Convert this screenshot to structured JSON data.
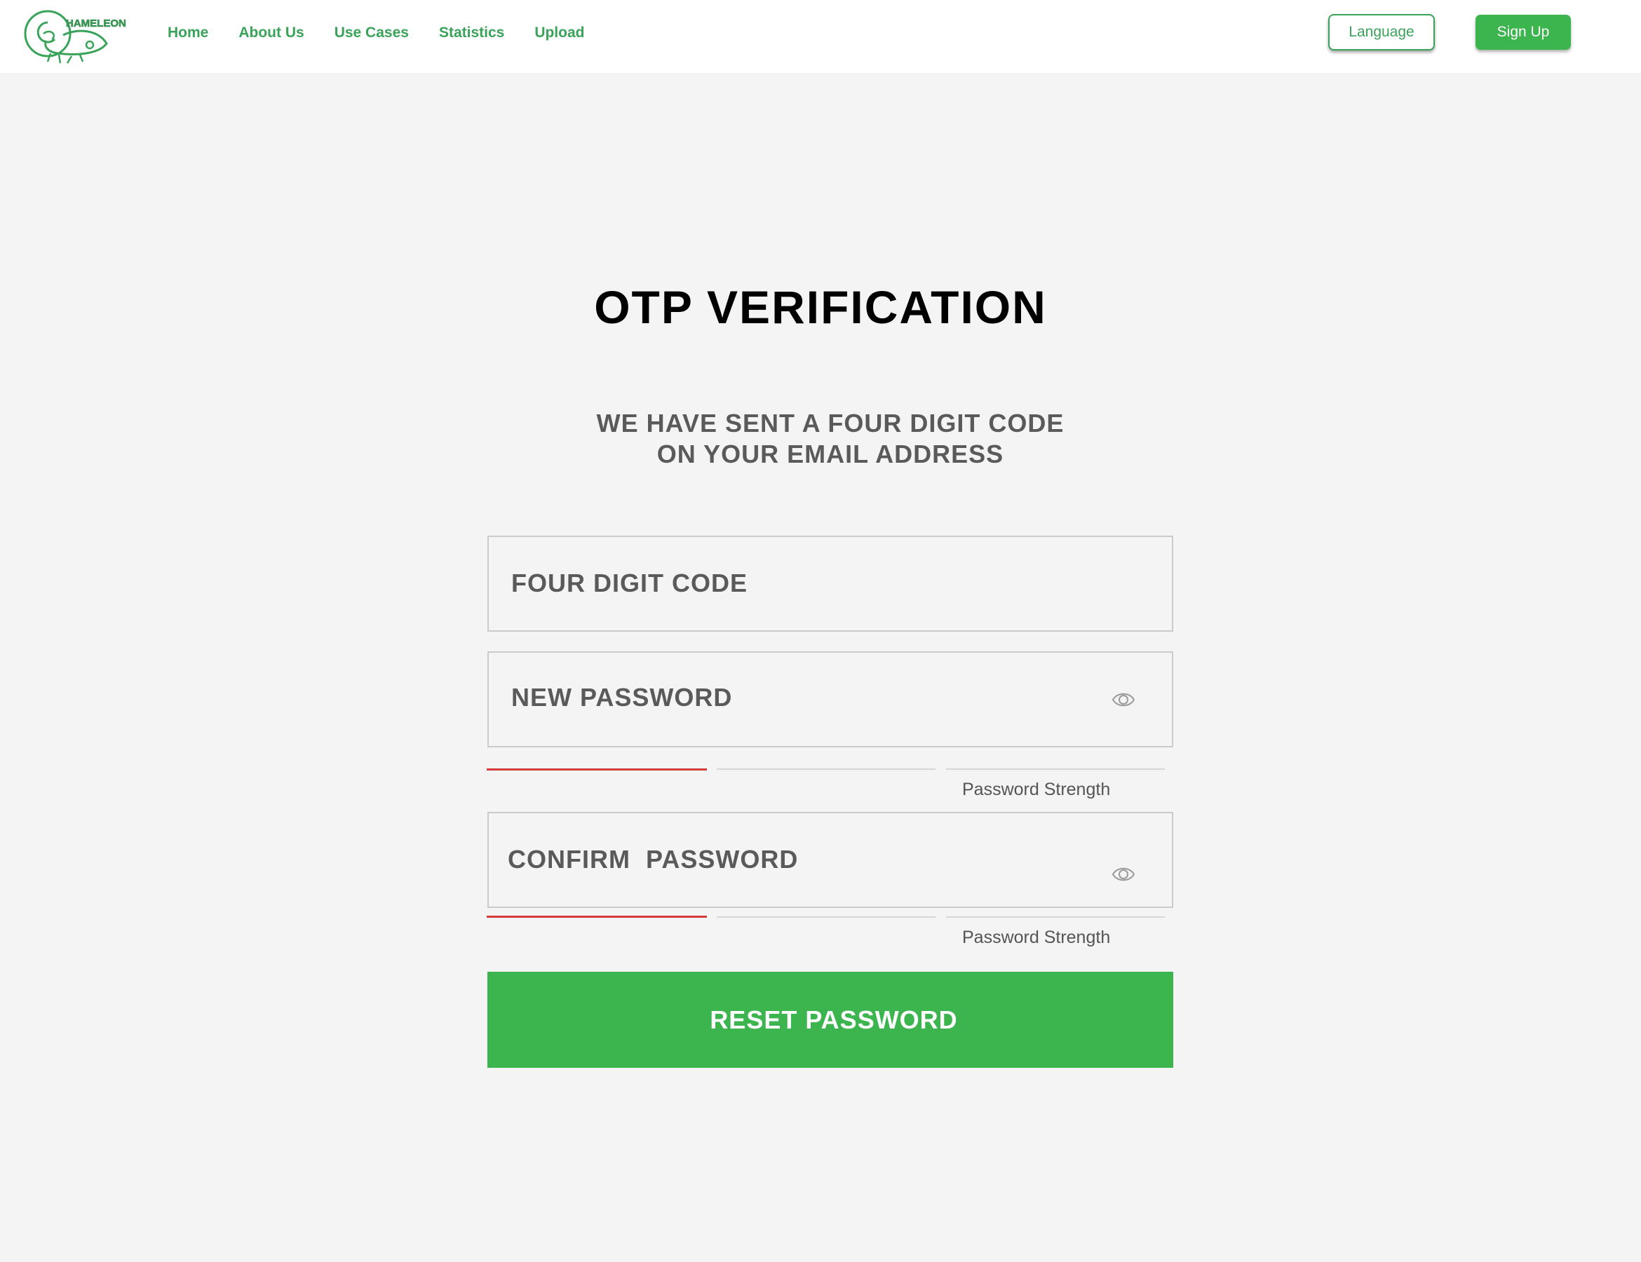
{
  "brand": {
    "logo_text": "HAMELEON",
    "color": "#3aa35a"
  },
  "nav": {
    "links": [
      "Home",
      "About Us",
      "Use Cases",
      "Statistics",
      "Upload"
    ],
    "language_label": "Language",
    "signup_label": "Sign Up"
  },
  "page": {
    "title": "OTP VERIFICATION",
    "subtitle_line1": "WE HAVE SENT A FOUR DIGIT CODE",
    "subtitle_line2": "ON YOUR EMAIL ADDRESS"
  },
  "form": {
    "code_placeholder": "FOUR DIGIT CODE",
    "new_password_placeholder": "NEW PASSWORD",
    "confirm_password_placeholder": "CONFIRM  PASSWORD",
    "strength_label": "Password Strength",
    "new_password_strength": 0.33,
    "confirm_password_strength": 0.33,
    "submit_label": "RESET PASSWORD"
  },
  "colors": {
    "accent": "#3cb54f",
    "nav_text": "#3aa35a",
    "weak_strength": "#d43a3a",
    "background": "#f4f4f4"
  },
  "icons": [
    "chameleon-logo-icon",
    "eye-icon"
  ]
}
